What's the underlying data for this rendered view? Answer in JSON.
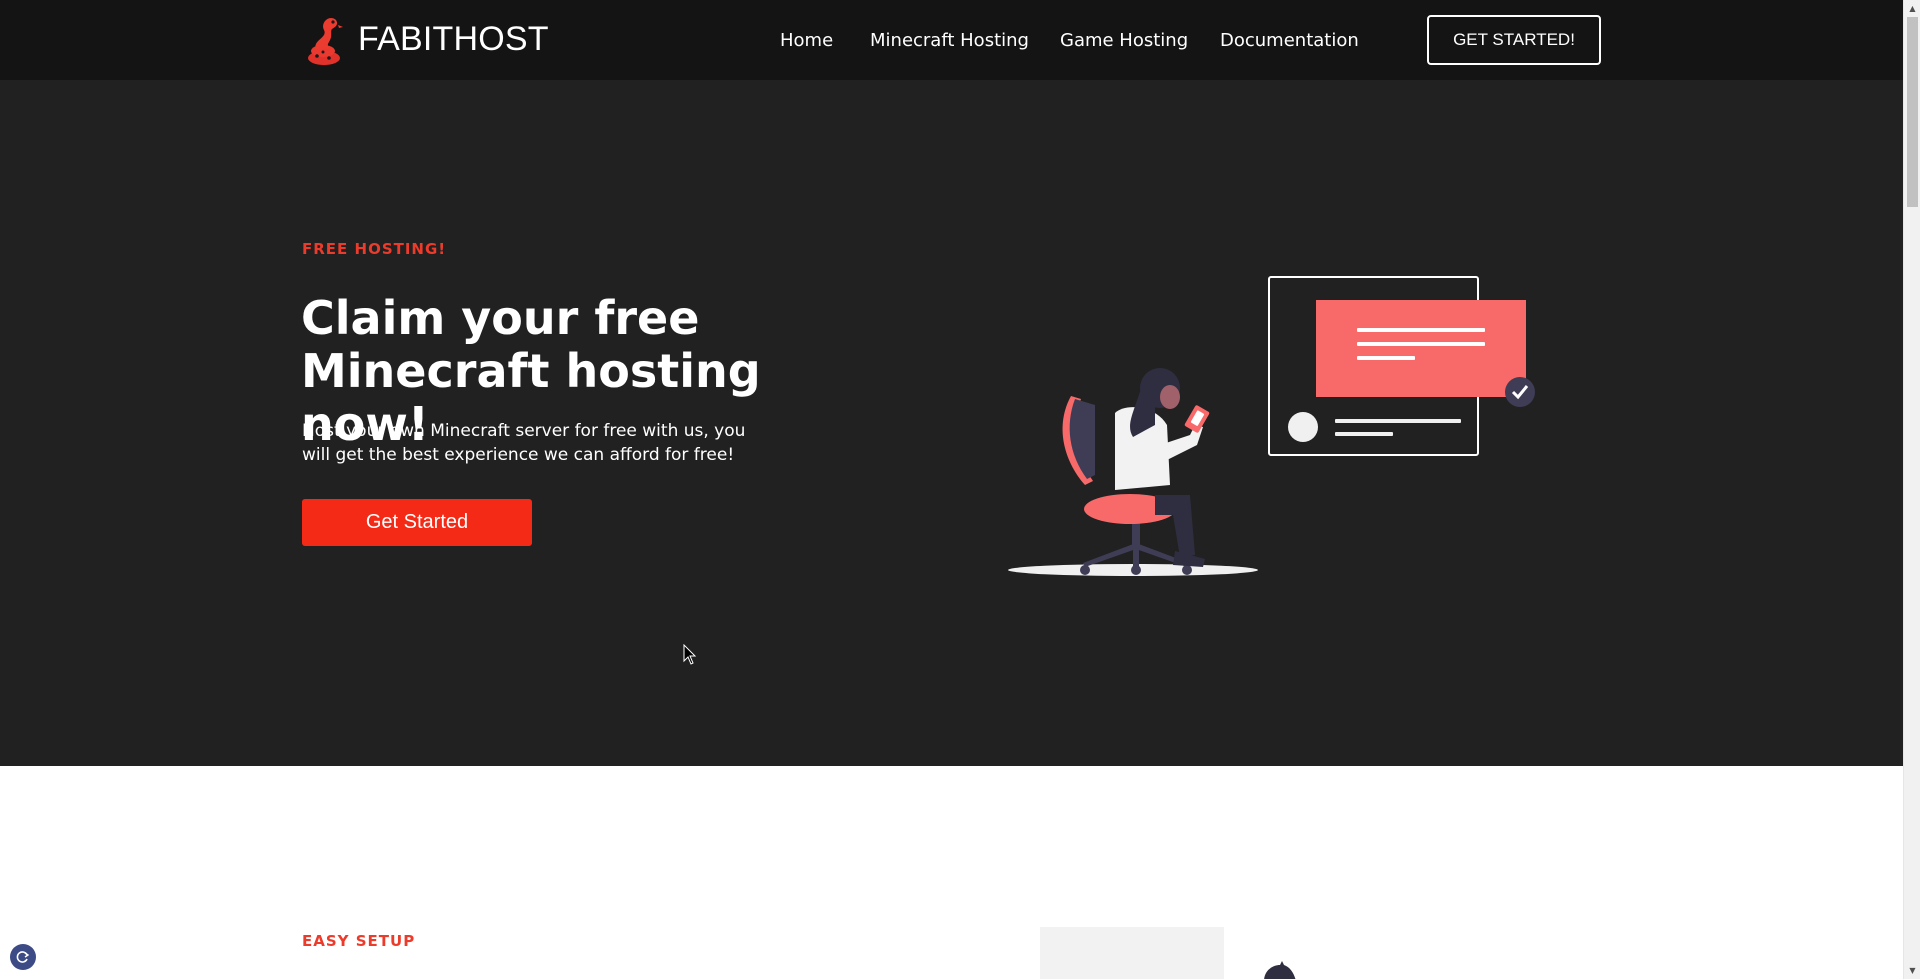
{
  "brand": {
    "name": "FABITHOST",
    "logo_icon": "red-snake-icon",
    "accent_color": "#f42a16"
  },
  "nav": {
    "links": [
      {
        "label": "Home"
      },
      {
        "label": "Minecraft Hosting"
      },
      {
        "label": "Game Hosting"
      },
      {
        "label": "Documentation"
      }
    ],
    "cta_label": "GET STARTED!"
  },
  "hero": {
    "eyebrow": "FREE HOSTING!",
    "headline": "Claim your free Minecraft hosting now!",
    "description": "Host your own Minecraft server for free with us, you will get the best experience we can afford for free!",
    "button_label": "Get Started",
    "illustration": "person-on-chair-with-phone-illustration",
    "background_color": "#212121"
  },
  "section2": {
    "eyebrow": "EASY SETUP"
  },
  "floating_widget": {
    "icon": "refresh-icon"
  }
}
